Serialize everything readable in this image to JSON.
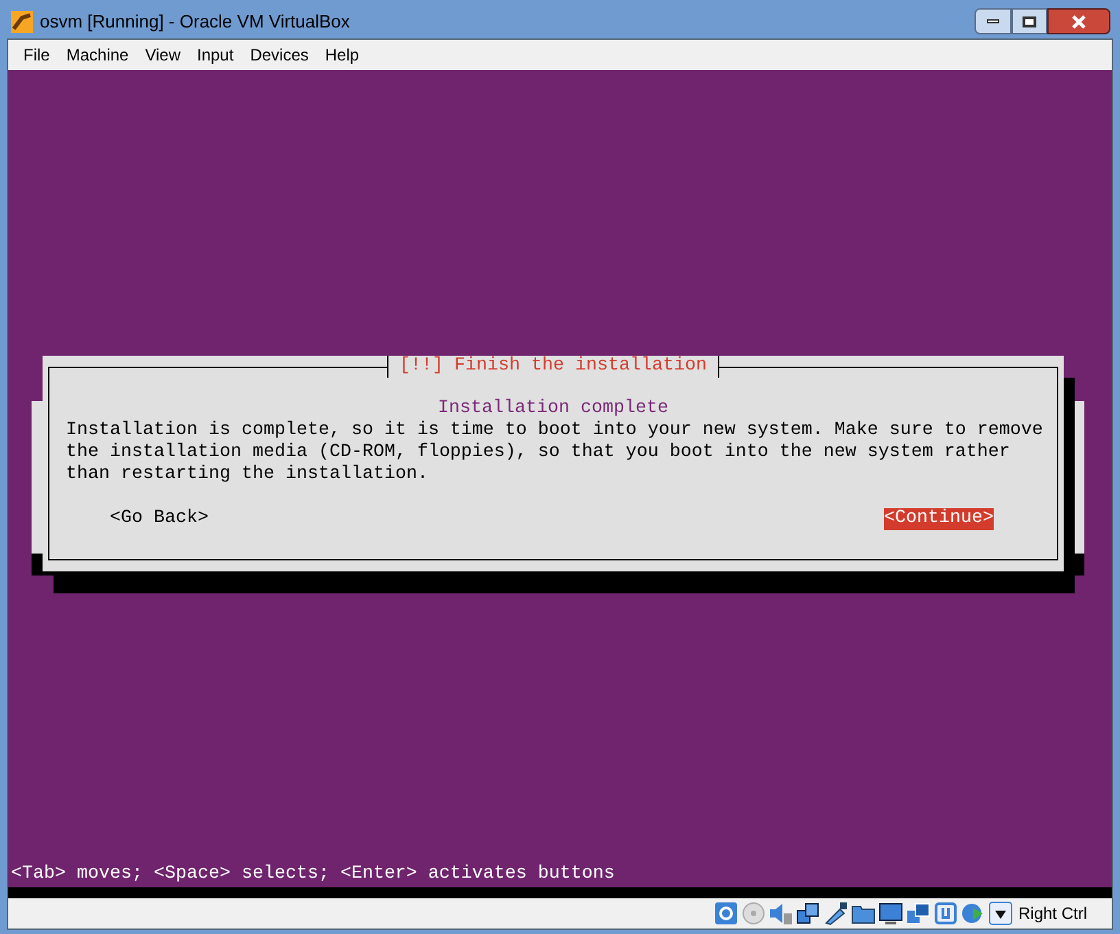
{
  "window": {
    "title": "osvm [Running] - Oracle VM VirtualBox"
  },
  "menu": [
    "File",
    "Machine",
    "View",
    "Input",
    "Devices",
    "Help"
  ],
  "dialog": {
    "title": "[!!] Finish the installation",
    "heading": "Installation complete",
    "body": "Installation is complete, so it is time to boot into your new system. Make sure to remove the installation media (CD-ROM, floppies), so that you boot into the new system rather than restarting the installation.",
    "buttons": [
      {
        "label": "<Go Back>",
        "selected": false
      },
      {
        "label": "<Continue>",
        "selected": true
      }
    ]
  },
  "hint": "<Tab> moves; <Space> selects; <Enter> activates buttons",
  "status_bar": {
    "host_key": "Right Ctrl"
  }
}
